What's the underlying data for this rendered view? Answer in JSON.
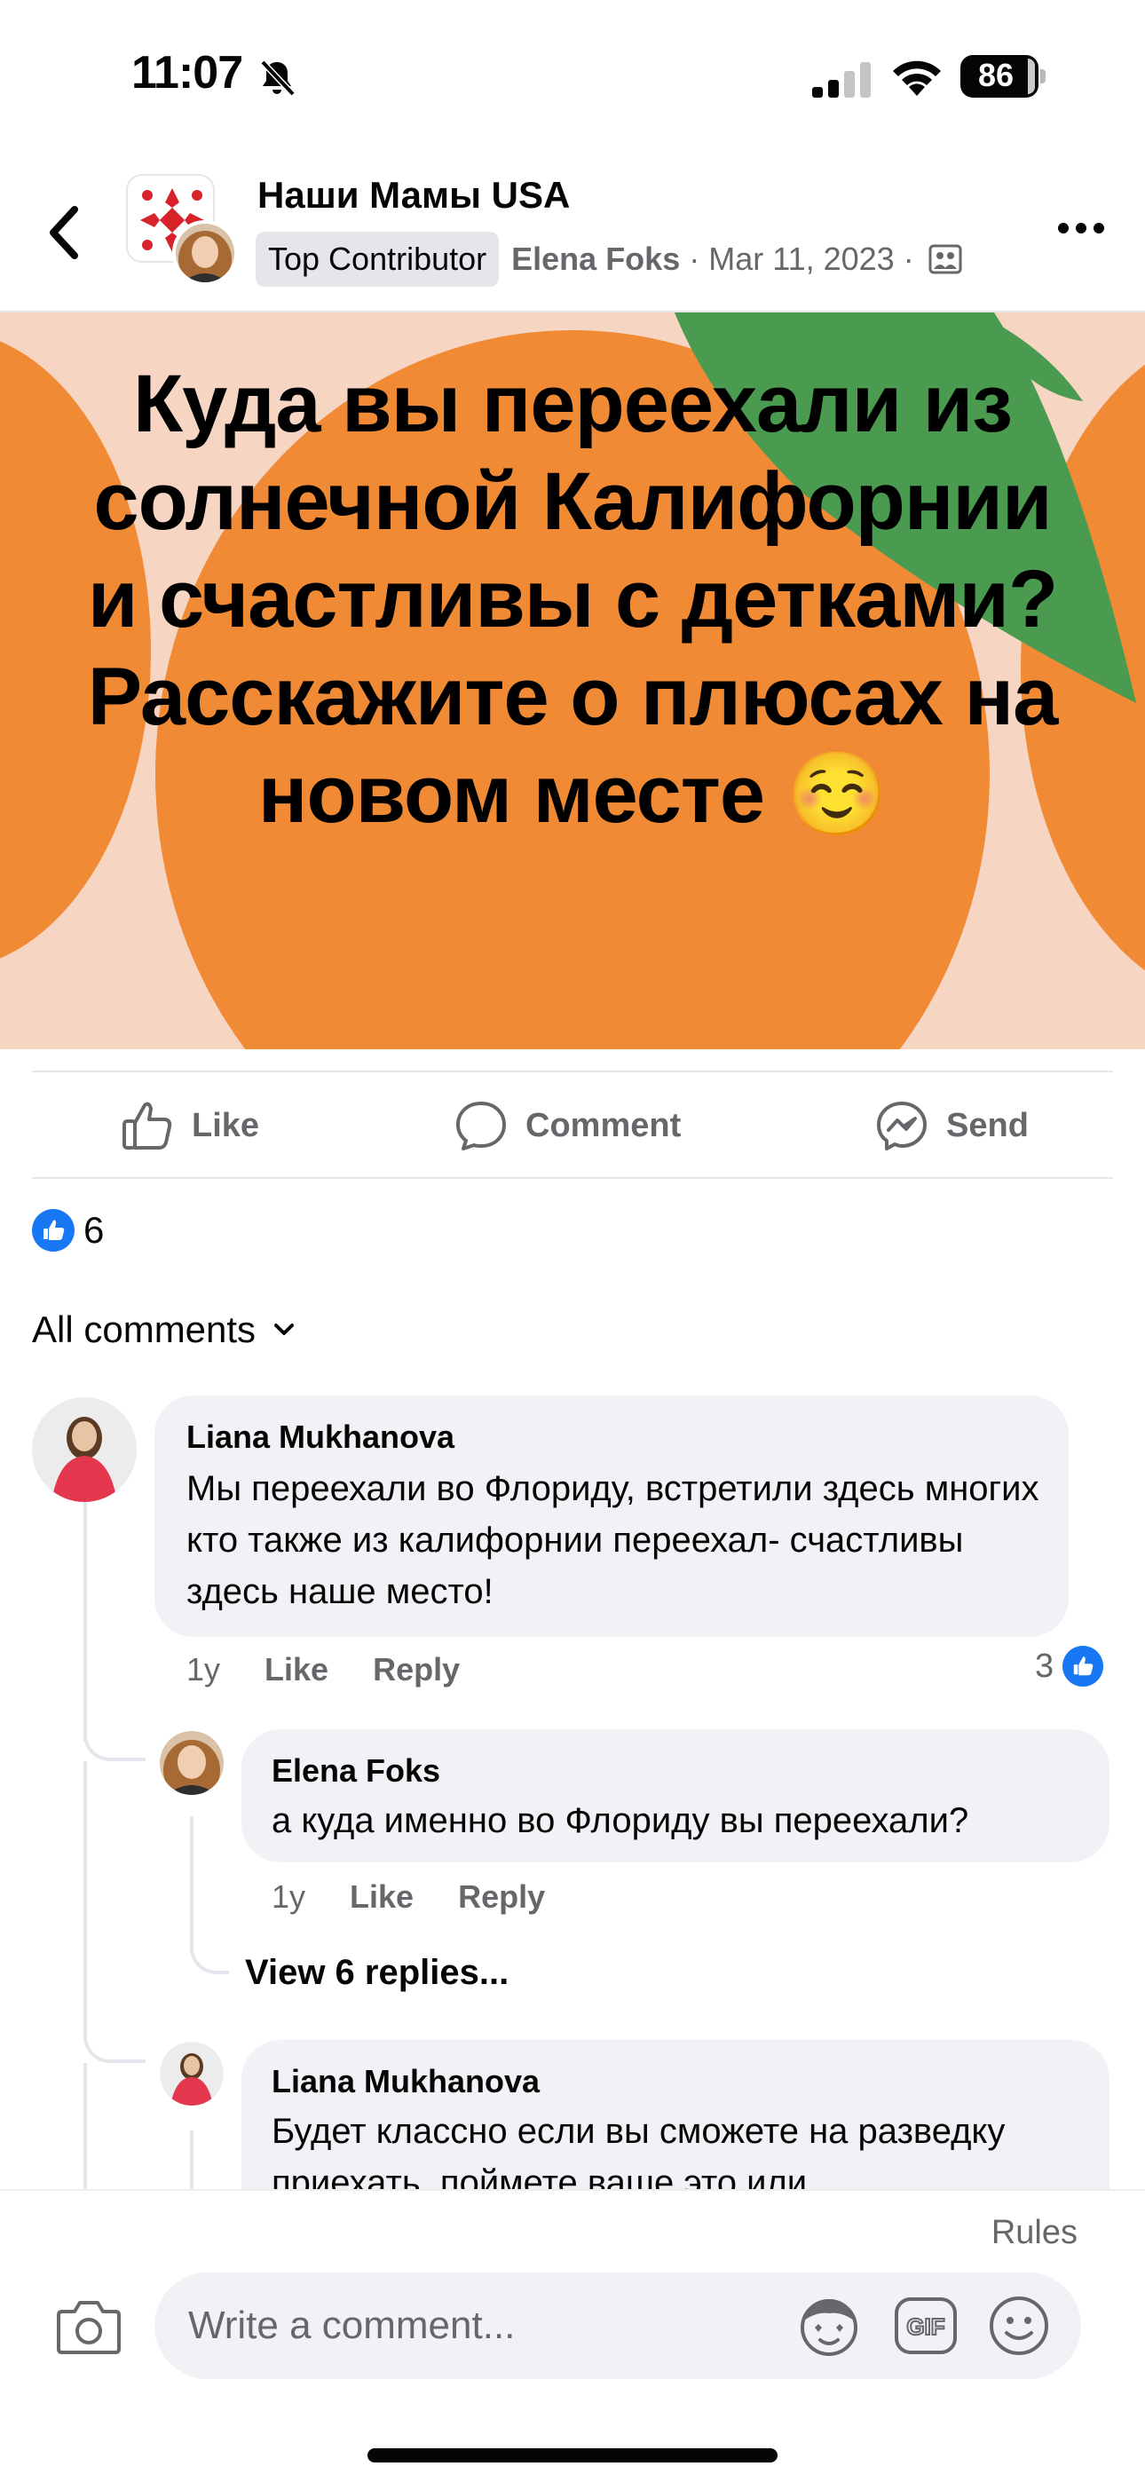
{
  "status_bar": {
    "time": "11:07",
    "battery": "86"
  },
  "header": {
    "group_name": "Наши Мамы USA",
    "badge": "Top Contributor",
    "author": "Elena Foks",
    "separator": "·",
    "date": "Mar 11, 2023"
  },
  "post": {
    "image_text": "Куда вы переехали из солнечной Калифорнии и счастливы с детками? Расскажите о плюсах на новом месте ☺️",
    "background_color": "#f6d5c3",
    "orange_color": "#f08a35",
    "leaf_color": "#4a9b50"
  },
  "actions": {
    "like": "Like",
    "comment": "Comment",
    "send": "Send"
  },
  "reactions": {
    "count": "6"
  },
  "comments_filter": {
    "label": "All comments"
  },
  "comments": [
    {
      "author": "Liana Mukhanova",
      "text": "Мы переехали во Флориду, встретили здесь многих кто также из калифорнии переехал- счастливы  здесь наше место!",
      "time": "1y",
      "like": "Like",
      "reply": "Reply",
      "reaction_count": "3"
    },
    {
      "author": "Elena Foks",
      "text": "а куда именно во Флориду вы переехали?",
      "time": "1y",
      "like": "Like",
      "reply": "Reply"
    },
    {
      "author": "Liana Mukhanova",
      "text": "Будет классно если вы сможете на разведку приехать, поймете ваше это или"
    }
  ],
  "view_replies": "View 6 replies...",
  "composer": {
    "rules": "Rules",
    "placeholder": "Write a comment..."
  },
  "colors": {
    "facebook_blue": "#1877f2",
    "secondary_text": "#65676b",
    "bubble": "#f0f2f5"
  }
}
